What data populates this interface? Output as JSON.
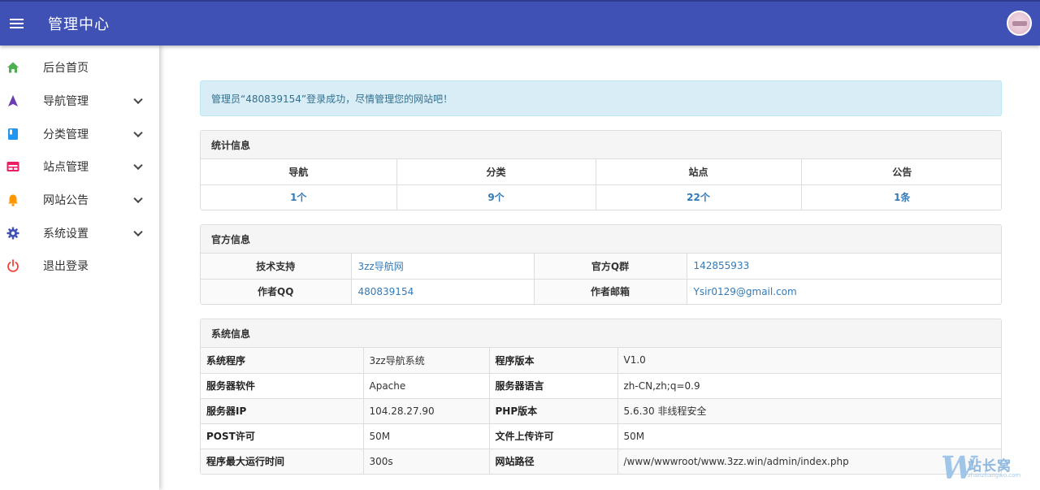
{
  "header": {
    "title": "管理中心"
  },
  "sidebar": {
    "items": [
      {
        "label": "后台首页",
        "icon": "home-icon",
        "color": "#4caf50"
      },
      {
        "label": "导航管理",
        "icon": "navigation-icon",
        "color": "#6a3eb0"
      },
      {
        "label": "分类管理",
        "icon": "book-icon",
        "color": "#2196f3"
      },
      {
        "label": "站点管理",
        "icon": "web-icon",
        "color": "#e91e63"
      },
      {
        "label": "网站公告",
        "icon": "bell-icon",
        "color": "#ff9800"
      },
      {
        "label": "系统设置",
        "icon": "gear-icon",
        "color": "#3f51b5"
      },
      {
        "label": "退出登录",
        "icon": "power-icon",
        "color": "#f44336"
      }
    ]
  },
  "alert": {
    "text": "管理员“480839154”登录成功，尽情管理您的网站吧！"
  },
  "stats": {
    "title": "统计信息",
    "headers": [
      "导航",
      "分类",
      "站点",
      "公告"
    ],
    "values": [
      "1个",
      "9个",
      "22个",
      "1条"
    ]
  },
  "official": {
    "title": "官方信息",
    "rows": [
      {
        "k1": "技术支持",
        "v1": "3zz导航网",
        "k2": "官方Q群",
        "v2": "142855933"
      },
      {
        "k1": "作者QQ",
        "v1": "480839154",
        "k2": "作者邮箱",
        "v2": "Ysir0129@gmail.com"
      }
    ]
  },
  "system": {
    "title": "系统信息",
    "rows": [
      {
        "k1": "系统程序",
        "v1": "3zz导航系统",
        "k2": "程序版本",
        "v2": "V1.0"
      },
      {
        "k1": "服务器软件",
        "v1": "Apache",
        "k2": "服务器语言",
        "v2": "zh-CN,zh;q=0.9"
      },
      {
        "k1": "服务器IP",
        "v1": "104.28.27.90",
        "k2": "PHP版本",
        "v2": "5.6.30 非线程安全"
      },
      {
        "k1": "POST许可",
        "v1": "50M",
        "k2": "文件上传许可",
        "v2": "50M"
      },
      {
        "k1": "程序最大运行时间",
        "v1": "300s",
        "k2": "网站路径",
        "v2": "/www/wwwroot/www.3zz.win/admin/index.php"
      }
    ]
  },
  "watermark": {
    "letter": "W",
    "text": "站长窝",
    "sub": "zhanzhangwo.com"
  }
}
